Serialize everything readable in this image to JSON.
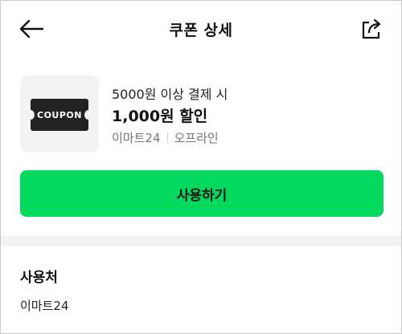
{
  "header": {
    "title": "쿠폰 상세",
    "back_icon": "arrow-left-icon",
    "share_icon": "share-icon"
  },
  "coupon": {
    "thumb_text": "COUPON",
    "condition": "5000원 이상 결제 시",
    "discount": "1,000원 할인",
    "store": "이마트24",
    "channel": "오프라인"
  },
  "actions": {
    "use_label": "사용하기",
    "accent_color": "#03d85f"
  },
  "usage": {
    "section_label": "사용처",
    "value": "이마트24"
  }
}
